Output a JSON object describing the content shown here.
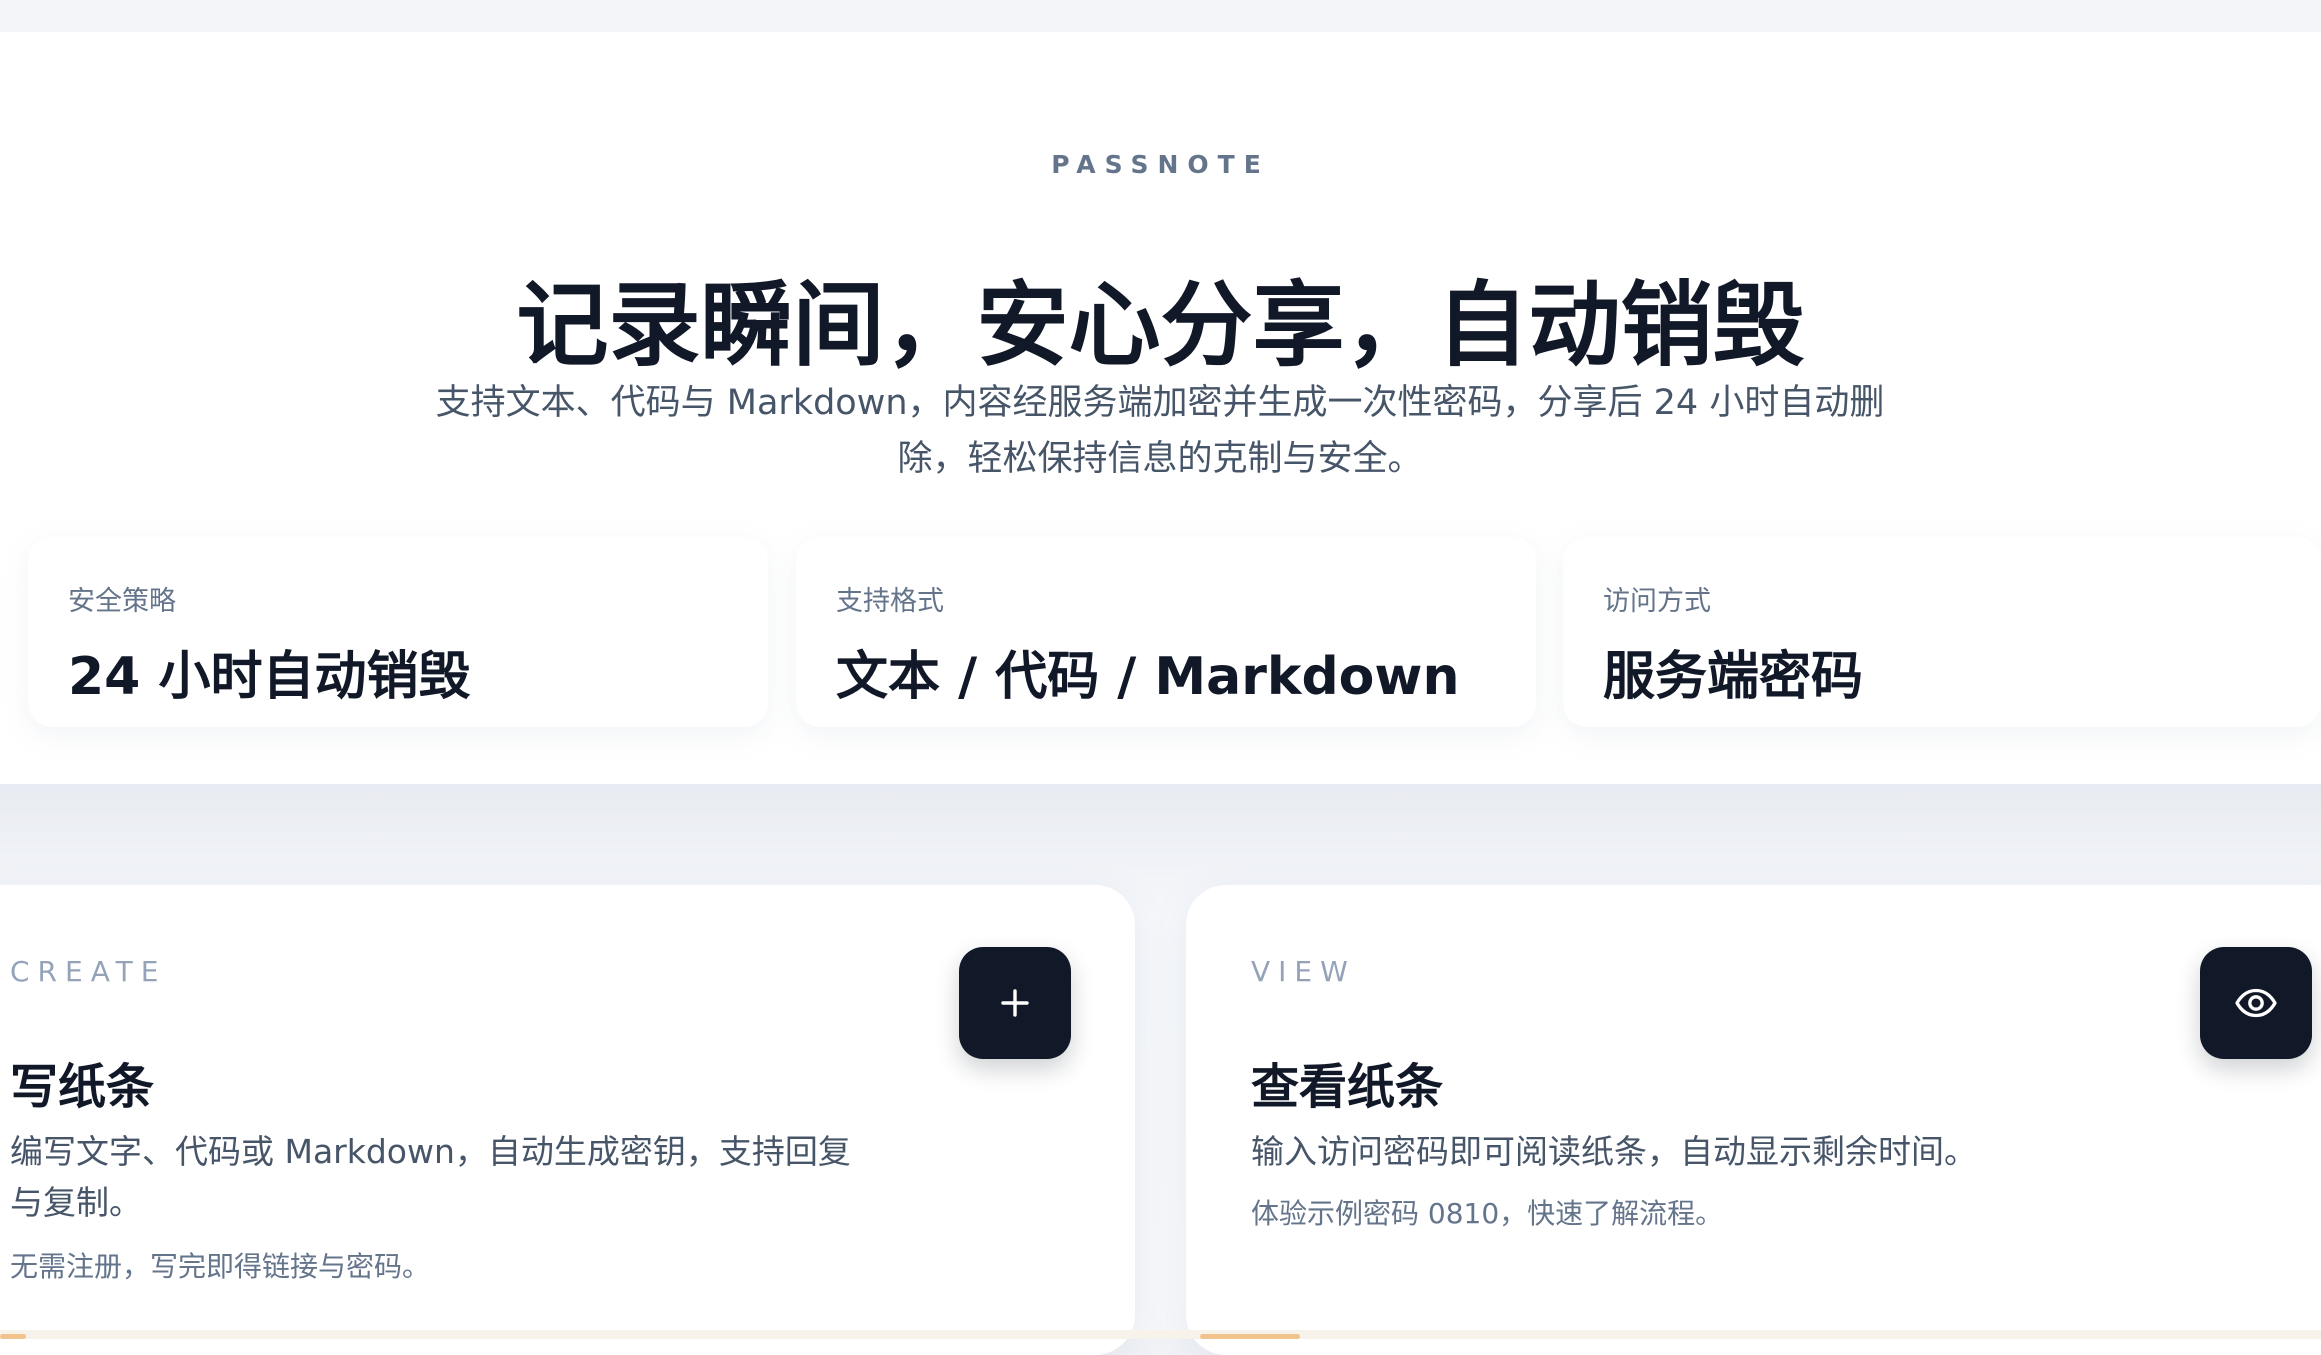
{
  "hero": {
    "eyebrow": "PASSNOTE",
    "title": "记录瞬间，安心分享，自动销毁",
    "subtitle": "支持文本、代码与 Markdown，内容经服务端加密并生成一次性密码，分享后 24 小时自动删除，轻松保持信息的克制与安全。"
  },
  "stats": [
    {
      "label": "安全策略",
      "value": "24 小时自动销毁"
    },
    {
      "label": "支持格式",
      "value": "文本 / 代码 / Markdown"
    },
    {
      "label": "访问方式",
      "value": "服务端密码"
    }
  ],
  "cards": {
    "create": {
      "eyebrow": "CREATE",
      "title": "写纸条",
      "description": "编写文字、代码或 Markdown，自动生成密钥，支持回复与复制。",
      "note": "无需注册，写完即得链接与密码。",
      "button_icon": "plus-icon"
    },
    "view": {
      "eyebrow": "VIEW",
      "title": "查看纸条",
      "description": "输入访问密码即可阅读纸条，自动显示剩余时间。",
      "note": "体验示例密码 0810，快速了解流程。",
      "button_icon": "eye-icon"
    }
  },
  "colors": {
    "primary_button": "#111827",
    "heading": "#111827",
    "body_text": "#475569",
    "muted_text": "#64748b",
    "background": "#f1f3f7"
  }
}
